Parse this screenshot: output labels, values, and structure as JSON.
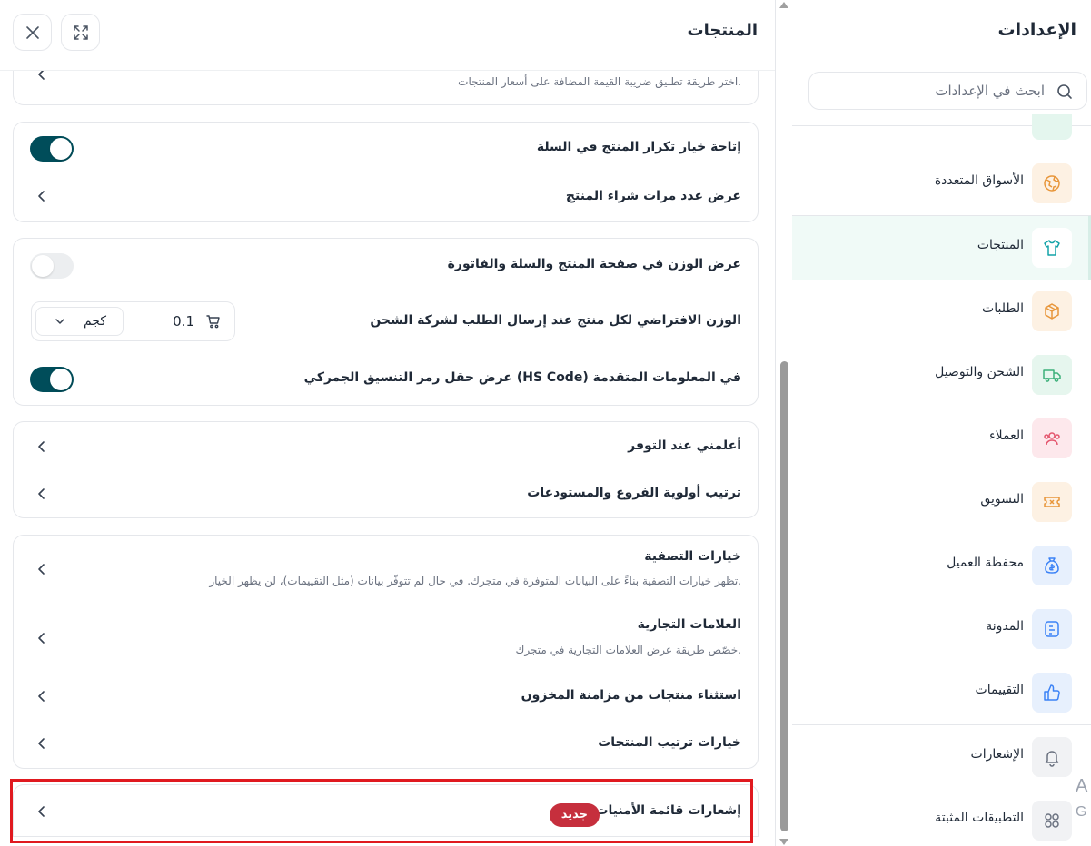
{
  "sidebar": {
    "title": "الإعدادات",
    "search_placeholder": "ابحث في الإعدادات",
    "items": [
      {
        "label": "الأسواق المتعددة",
        "icon": "globe-icon",
        "bg": "#fdf1e3",
        "color": "#e8963a"
      },
      {
        "label": "المنتجات",
        "icon": "tshirt-icon",
        "bg": "#ffffff",
        "color": "#14a3a8",
        "active": true
      },
      {
        "label": "الطلبات",
        "icon": "box-icon",
        "bg": "#fdf1e3",
        "color": "#e8963a"
      },
      {
        "label": "الشحن والتوصيل",
        "icon": "truck-icon",
        "bg": "#e6f6ee",
        "color": "#3db07a"
      },
      {
        "label": "العملاء",
        "icon": "users-icon",
        "bg": "#fde8ec",
        "color": "#e4566e"
      },
      {
        "label": "التسويق",
        "icon": "ticket-icon",
        "bg": "#fdf1e3",
        "color": "#e8963a"
      },
      {
        "label": "محفظة العميل",
        "icon": "money-bag-icon",
        "bg": "#e7f0fd",
        "color": "#3b82f6"
      },
      {
        "label": "المدونة",
        "icon": "blog-icon",
        "bg": "#e7f0fd",
        "color": "#3b82f6"
      },
      {
        "label": "التقييمات",
        "icon": "thumbs-up-icon",
        "bg": "#e7f0fd",
        "color": "#3b82f6"
      },
      {
        "label": "الإشعارات",
        "icon": "bell-icon",
        "bg": "#f1f2f4",
        "color": "#6b7280"
      },
      {
        "label": "التطبيقات المثبتة",
        "icon": "apps-grid-icon",
        "bg": "#f1f2f4",
        "color": "#6b7280"
      }
    ]
  },
  "panel": {
    "title": "المنتجات",
    "tax_desc": "اختر طريقة تطبيق ضريبة القيمة المضافة على أسعار المنتجات.",
    "card1": {
      "repeat_label": "إتاحة خيار تكرار المنتج في السلة",
      "repeat_on": true,
      "purchase_count_label": "عرض عدد مرات شراء المنتج"
    },
    "card2": {
      "weight_display_label": "عرض الوزن في صفحة المنتج والسلة والفاتورة",
      "weight_display_on": false,
      "default_weight_label": "الوزن الافتراضي لكل منتج عند إرسال الطلب لشركة الشحن",
      "default_weight_value": "0.1",
      "weight_unit": "كجم",
      "hs_code_label": "عرض حقل رمز التنسيق الجمركي (HS Code) في المعلومات المتقدمة",
      "hs_code_on": true
    },
    "card3": {
      "notify_label": "أعلمني عند التوفر",
      "priority_label": "ترتيب أولوية الفروع والمستودعات"
    },
    "card4": {
      "filter_title": "خيارات التصفية",
      "filter_desc": "تظهر خيارات التصفية بناءً على البيانات المتوفرة في متجرك. في حال لم تتوفّر بيانات (مثل التقييمات)، لن يظهر الخيار.",
      "brands_title": "العلامات التجارية",
      "brands_desc": "خصّص طريقة عرض العلامات التجارية في متجرك.",
      "exclude_label": "استثناء منتجات من مزامنة المخزون",
      "sort_label": "خيارات ترتيب المنتجات"
    },
    "card5": {
      "wishlist_label": "إشعارات قائمة الأمنيات",
      "badge": "جديد"
    }
  },
  "edge_text": {
    "a": "A",
    "b": "G"
  },
  "colors": {
    "toggle_on": "#004d5a",
    "badge": "#c62f3d",
    "highlight": "#e0191f"
  }
}
